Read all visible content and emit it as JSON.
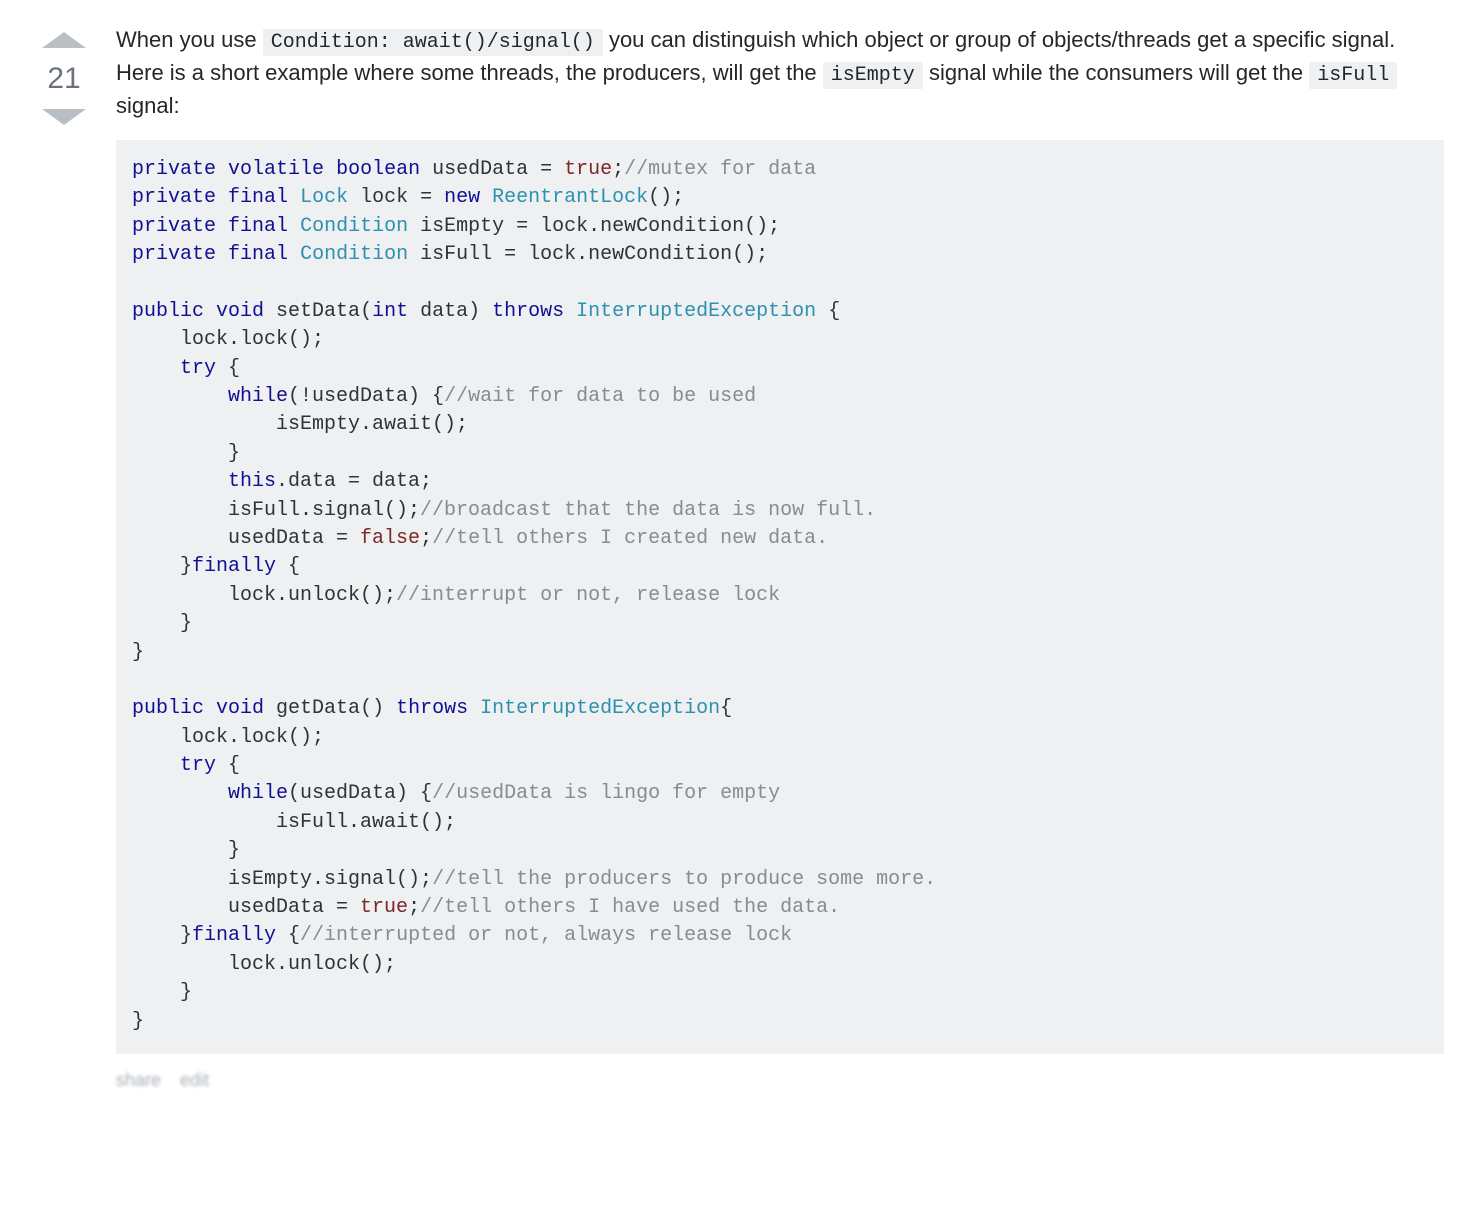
{
  "vote": {
    "count": "21"
  },
  "post": {
    "prose": {
      "p1a": "When you use ",
      "inline1": "Condition: await()/signal()",
      "p1b": " you can distinguish which object or group of objects/threads get a specific signal. Here is a short example where some threads, the producers, will get the ",
      "inline2": "isEmpty",
      "p1c": " signal while the consumers will get the ",
      "inline3": "isFull",
      "p1d": " signal:"
    }
  },
  "code": {
    "l01": {
      "kw1": "private",
      "kw2": "volatile",
      "kw3": "boolean",
      "rest": " usedData = ",
      "lit": "true",
      "tail": ";",
      "com": "//mutex for data"
    },
    "l02": {
      "kw1": "private",
      "kw2": "final",
      "typ": "Lock",
      "mid1": " lock = ",
      "kw3": "new",
      "typ2": "ReentrantLock",
      "mid2": "();"
    },
    "l03": {
      "kw1": "private",
      "kw2": "final",
      "typ": "Condition",
      "rest": " isEmpty = lock.newCondition();"
    },
    "l04": {
      "kw1": "private",
      "kw2": "final",
      "typ": "Condition",
      "rest": " isFull = lock.newCondition();"
    },
    "l06": {
      "kw1": "public",
      "kw2": "void",
      "name": " setData(",
      "kw3": "int",
      "mid": " data) ",
      "kw4": "throws",
      "typ": "InterruptedException",
      "tail": " {"
    },
    "l07": {
      "txt": "    lock.lock();"
    },
    "l08": {
      "pre": "    ",
      "kw": "try",
      "post": " {"
    },
    "l09": {
      "pre": "        ",
      "kw": "while",
      "post": "(!usedData) {",
      "com": "//wait for data to be used"
    },
    "l10": {
      "txt": "            isEmpty.await();"
    },
    "l11": {
      "txt": "        }"
    },
    "l12": {
      "pre": "        ",
      "kw": "this",
      "post": ".data = data;"
    },
    "l13": {
      "txt": "        isFull.signal();",
      "com": "//broadcast that the data is now full."
    },
    "l14": {
      "txt": "        usedData = ",
      "lit": "false",
      "tail": ";",
      "com": "//tell others I created new data."
    },
    "l15": {
      "pre": "    }",
      "kw": "finally",
      "post": " {"
    },
    "l16": {
      "txt": "        lock.unlock();",
      "com": "//interrupt or not, release lock"
    },
    "l17": {
      "txt": "    }"
    },
    "l18": {
      "txt": "}"
    },
    "l20": {
      "kw1": "public",
      "kw2": "void",
      "name": " getData() ",
      "kw3": "throws",
      "typ": "InterruptedException",
      "tail": "{"
    },
    "l21": {
      "txt": "    lock.lock();"
    },
    "l22": {
      "pre": "    ",
      "kw": "try",
      "post": " {"
    },
    "l23": {
      "pre": "        ",
      "kw": "while",
      "post": "(usedData) {",
      "com": "//usedData is lingo for empty"
    },
    "l24": {
      "txt": "            isFull.await();"
    },
    "l25": {
      "txt": "        }"
    },
    "l26": {
      "txt": "        isEmpty.signal();",
      "com": "//tell the producers to produce some more."
    },
    "l27": {
      "txt": "        usedData = ",
      "lit": "true",
      "tail": ";",
      "com": "//tell others I have used the data."
    },
    "l28": {
      "pre": "    }",
      "kw": "finally",
      "post": " {",
      "com": "//interrupted or not, always release lock"
    },
    "l29": {
      "txt": "        lock.unlock();"
    },
    "l30": {
      "txt": "    }"
    },
    "l31": {
      "txt": "}"
    }
  },
  "menu": {
    "share": "share",
    "edit": "edit"
  }
}
